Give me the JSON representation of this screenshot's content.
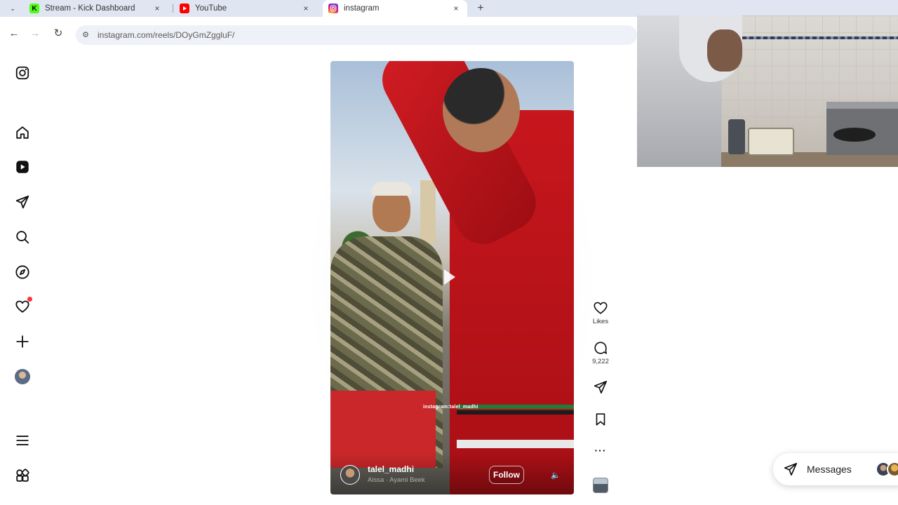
{
  "browser": {
    "tabs": [
      {
        "title": "Stream - Kick Dashboard",
        "favicon_letter": "K",
        "favicon_color": "#53fc18",
        "active": false
      },
      {
        "title": "YouTube",
        "favicon_color": "#ff0000",
        "active": false
      },
      {
        "title": "instagram",
        "favicon_color": "#d62976",
        "active": true
      }
    ],
    "close_glyph": "×",
    "newtab_glyph": "+",
    "tab_search_glyph": "⌄",
    "url": "instagram.com/reels/DOyGmZggluF/",
    "back_glyph": "←",
    "forward_glyph": "→",
    "reload_glyph": "↻",
    "site_info_glyph": "⚙"
  },
  "rail": {
    "items": [
      {
        "name": "instagram-logo-icon"
      },
      {
        "name": "home-icon"
      },
      {
        "name": "reels-icon"
      },
      {
        "name": "direct-messages-icon"
      },
      {
        "name": "search-icon"
      },
      {
        "name": "explore-icon"
      },
      {
        "name": "notifications-heart-icon",
        "has_dot": true
      },
      {
        "name": "create-plus-icon"
      },
      {
        "name": "profile-avatar"
      },
      {
        "name": "more-menu-icon"
      },
      {
        "name": "also-from-meta-icon"
      }
    ]
  },
  "reel": {
    "username": "talel_madhi",
    "audio": "Aissa · Ayami Beek",
    "watermark": "instagram:talel_madhi",
    "follow_label": "Follow",
    "mute_glyph": "🔈"
  },
  "actions": {
    "likes_label": "Likes",
    "comments_count": "9,222",
    "more_glyph": "···"
  },
  "messages": {
    "label": "Messages"
  },
  "colors": {
    "tabstrip_bg": "#dfe6f1",
    "omnibox_bg": "#eef1f7",
    "notification_dot": "#ff3040",
    "jersey_red": "#c7161d"
  }
}
